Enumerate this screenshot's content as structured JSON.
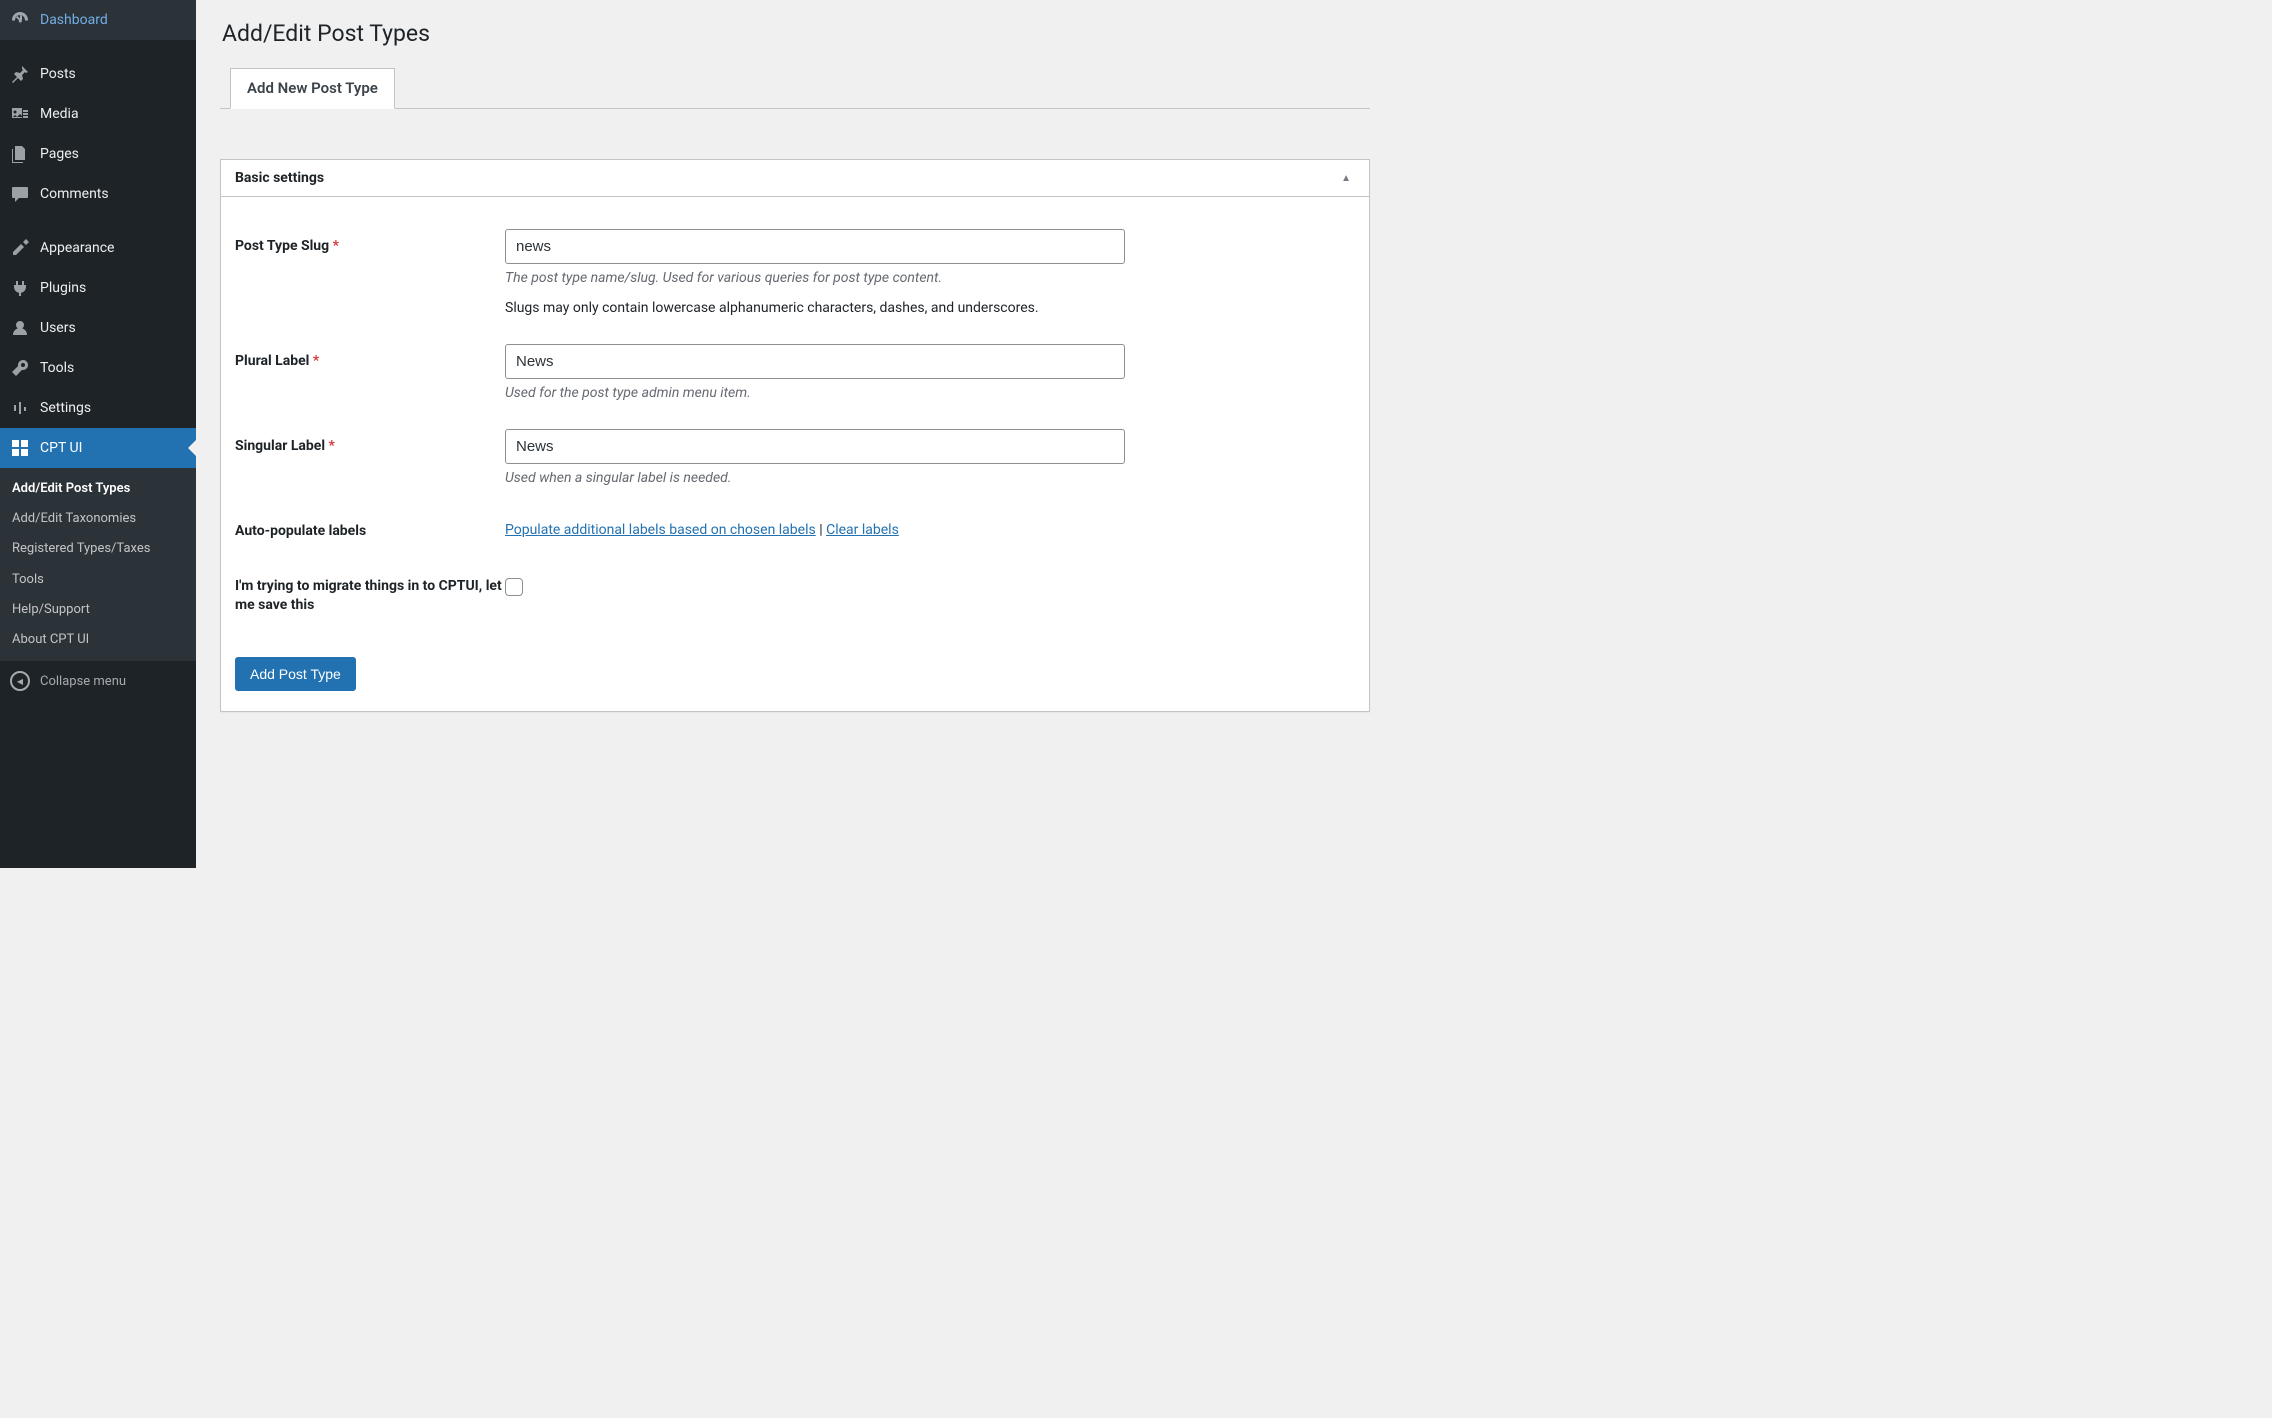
{
  "sidebar": {
    "items": [
      {
        "label": "Dashboard"
      },
      {
        "label": "Posts"
      },
      {
        "label": "Media"
      },
      {
        "label": "Pages"
      },
      {
        "label": "Comments"
      },
      {
        "label": "Appearance"
      },
      {
        "label": "Plugins"
      },
      {
        "label": "Users"
      },
      {
        "label": "Tools"
      },
      {
        "label": "Settings"
      },
      {
        "label": "CPT UI"
      }
    ],
    "submenu": [
      {
        "label": "Add/Edit Post Types",
        "current": true
      },
      {
        "label": "Add/Edit Taxonomies"
      },
      {
        "label": "Registered Types/Taxes"
      },
      {
        "label": "Tools"
      },
      {
        "label": "Help/Support"
      },
      {
        "label": "About CPT UI"
      }
    ],
    "collapse_label": "Collapse menu"
  },
  "page": {
    "title": "Add/Edit Post Types",
    "tab_label": "Add New Post Type"
  },
  "panel": {
    "title": "Basic settings"
  },
  "form": {
    "slug": {
      "label": "Post Type Slug",
      "value": "news",
      "desc": "The post type name/slug. Used for various queries for post type content.",
      "note": "Slugs may only contain lowercase alphanumeric characters, dashes, and underscores."
    },
    "plural": {
      "label": "Plural Label",
      "value": "News",
      "desc": "Used for the post type admin menu item."
    },
    "singular": {
      "label": "Singular Label",
      "value": "News",
      "desc": "Used when a singular label is needed."
    },
    "autopop": {
      "label": "Auto-populate labels",
      "link_populate": "Populate additional labels based on chosen labels",
      "sep": " | ",
      "link_clear": "Clear labels"
    },
    "migrate": {
      "label": "I'm trying to migrate things in to CPTUI, let me save this"
    },
    "submit_label": "Add Post Type"
  }
}
